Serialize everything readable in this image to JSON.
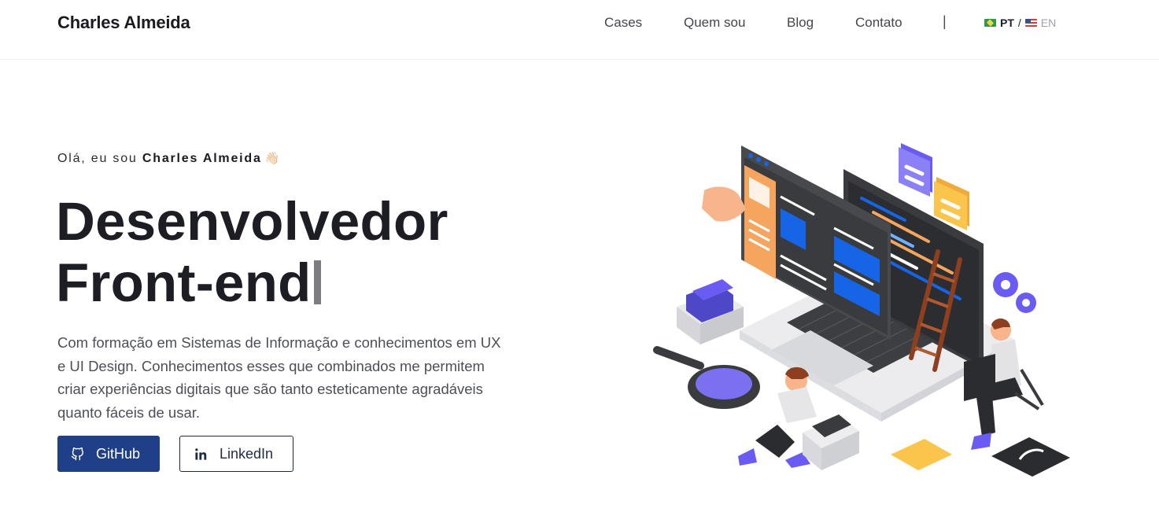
{
  "header": {
    "brand": "Charles Almeida",
    "nav": [
      "Cases",
      "Quem sou",
      "Blog",
      "Contato"
    ],
    "separator": "|",
    "lang": {
      "pt": "PT",
      "slash": "/",
      "en": "EN"
    }
  },
  "hero": {
    "greeting_prefix": "Olá, eu sou",
    "greeting_name": "Charles Almeida",
    "wave_emoji": "👋🏻",
    "title_line1": "Desenvolvedor",
    "title_line2": "Front-end",
    "description": "Com formação em Sistemas de Informação e conhecimentos em UX e UI Design. Conhecimentos esses que combinados me permitem criar experiências digitais que são tanto esteticamente agradáveis quanto fáceis de usar.",
    "buttons": {
      "github": "GitHub",
      "linkedin": "LinkedIn"
    }
  },
  "colors": {
    "primary_button": "#1f3f88",
    "text_dark": "#1d1e24",
    "accent_blue": "#1565e6",
    "accent_orange": "#f6a55e",
    "accent_purple": "#6a5cf2"
  },
  "icons": [
    "github-icon",
    "linkedin-icon",
    "brazil-flag-icon",
    "usa-flag-icon"
  ]
}
